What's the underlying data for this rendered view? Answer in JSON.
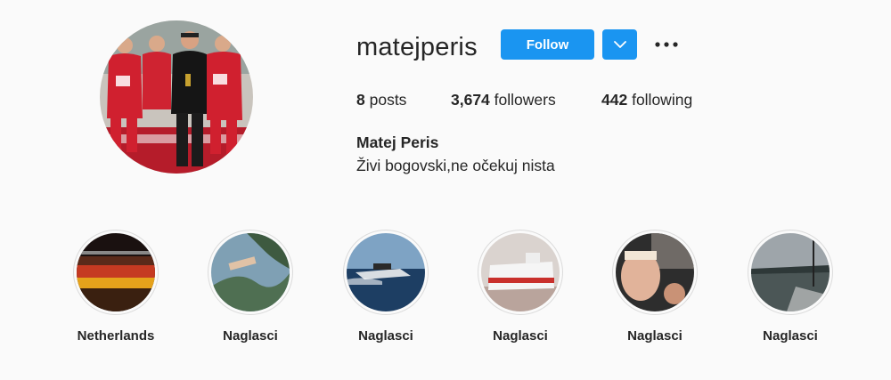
{
  "profile": {
    "username": "matejperis",
    "follow_label": "Follow",
    "full_name": "Matej Peris",
    "bio": "Živi bogovski,ne očekuj nista"
  },
  "stats": {
    "posts_count": "8",
    "posts_label": "posts",
    "followers_count": "3,674",
    "followers_label": "followers",
    "following_count": "442",
    "following_label": "following"
  },
  "highlights": [
    {
      "label": "Netherlands"
    },
    {
      "label": "Naglasci"
    },
    {
      "label": "Naglasci"
    },
    {
      "label": "Naglasci"
    },
    {
      "label": "Naglasci"
    },
    {
      "label": "Naglasci"
    }
  ],
  "icons": {
    "dropdown": "chevron-down-icon",
    "more": "more-options-icon"
  },
  "colors": {
    "accent": "#1a95f1",
    "background": "#fafafa",
    "text": "#262626"
  }
}
